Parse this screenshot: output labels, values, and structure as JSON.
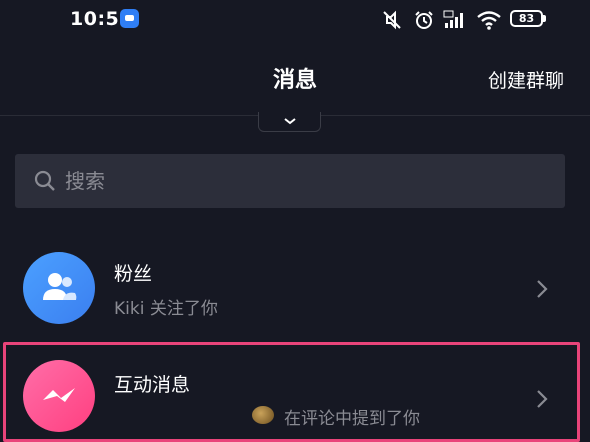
{
  "status_bar": {
    "time": "10:51",
    "battery": "83",
    "icons": [
      "app-badge-icon",
      "mute-icon",
      "alarm-icon",
      "hd-signal-icon",
      "wifi-icon",
      "battery-icon"
    ]
  },
  "header": {
    "title": "消息",
    "create_group": "创建群聊"
  },
  "search": {
    "placeholder": "搜索"
  },
  "list": [
    {
      "title": "粉丝",
      "subtitle": "Kiki 关注了你",
      "icon": "fans-icon",
      "color": "#3b8df5"
    },
    {
      "title": "互动消息",
      "subtitle": "在评论中提到了你",
      "icon": "interaction-icon",
      "color": "#ff4f8b"
    }
  ],
  "colors": {
    "background": "#161823",
    "search_bg": "#2c2e3a",
    "highlight": "#e9447a",
    "muted_text": "#8a8b93"
  }
}
